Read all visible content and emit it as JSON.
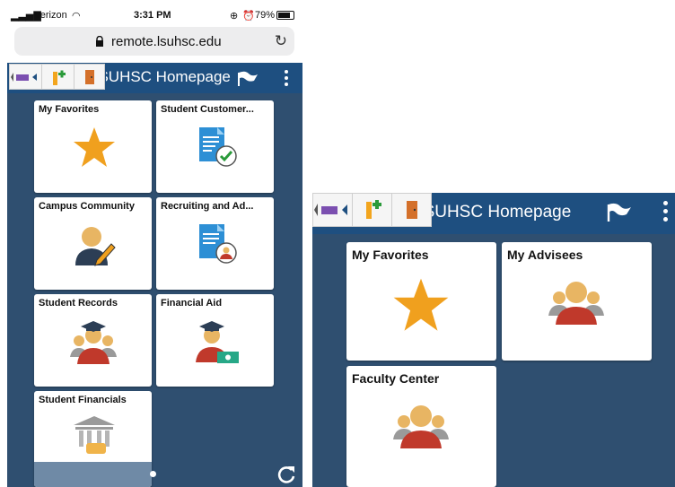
{
  "phone": {
    "status": {
      "carrier": "Verizon",
      "time": "3:31 PM",
      "battery": "79%"
    },
    "url": "remote.lsuhsc.edu",
    "banner_title": "LSUHSC Homepage",
    "tiles": [
      {
        "label": "My Favorites",
        "icon": "star-icon"
      },
      {
        "label": "Student Customer...",
        "icon": "document-check-icon"
      },
      {
        "label": "Campus Community",
        "icon": "person-pencil-icon"
      },
      {
        "label": "Recruiting and Ad...",
        "icon": "document-person-icon"
      },
      {
        "label": "Student Records",
        "icon": "graduates-icon"
      },
      {
        "label": "Financial Aid",
        "icon": "graduate-money-icon"
      },
      {
        "label": "Student Financials",
        "icon": "bank-icon"
      }
    ]
  },
  "tablet": {
    "banner_title": "LSUHSC Homepage",
    "tiles": [
      {
        "label": "My Favorites",
        "icon": "star-icon"
      },
      {
        "label": "My Advisees",
        "icon": "group-icon"
      },
      {
        "label": "Faculty Center",
        "icon": "group-icon"
      }
    ]
  },
  "colors": {
    "banner": "#1e4f80",
    "body": "#2f4f70",
    "star": "#f0a01e",
    "person_red": "#c0392b",
    "person_tan": "#e8b563"
  }
}
